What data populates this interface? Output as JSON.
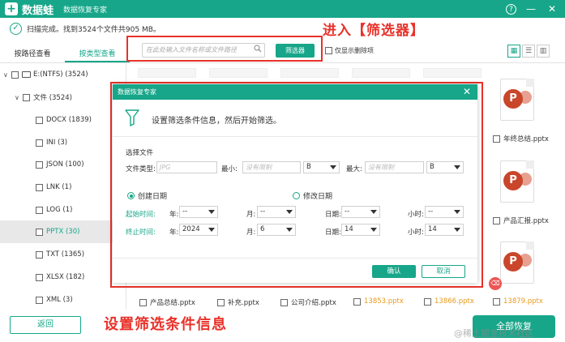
{
  "titlebar": {
    "logo_glyph": "+",
    "app_name": "数据蛙",
    "subtitle": "数据恢复专家",
    "help": "?",
    "minimize": "—",
    "close": "✕"
  },
  "status": {
    "check": "✓",
    "text": "扫描完成。找到3524个文件共905 MB。"
  },
  "annotations": {
    "top": "进入【筛选器】",
    "bottom": "设置筛选条件信息"
  },
  "tabs": [
    {
      "label": "按路径查看"
    },
    {
      "label": "按类型查看"
    }
  ],
  "toolbar": {
    "search_placeholder": "在此处输入文件名称或文件路径",
    "filter_label": "筛选器",
    "show_deleted": "仅显示删除项"
  },
  "tree": [
    {
      "arrow": "∨",
      "label": "E:(NTFS) (3524)"
    },
    {
      "arrow": "∨",
      "label": "文件 (3524)"
    },
    {
      "label": "DOCX (1839)"
    },
    {
      "label": "INI (3)"
    },
    {
      "label": "JSON (100)"
    },
    {
      "label": "LNK (1)"
    },
    {
      "label": "LOG (1)"
    },
    {
      "label": "PPTX (30)"
    },
    {
      "label": "TXT (1365)"
    },
    {
      "label": "XLSX (182)"
    },
    {
      "label": "XML (3)"
    }
  ],
  "files": {
    "right_col": [
      {
        "name": "年终总结.pptx"
      },
      {
        "name": "产品汇报.pptx"
      }
    ],
    "bottom_row": [
      {
        "name": "产品总结.pptx"
      },
      {
        "name": "补充.pptx"
      },
      {
        "name": "公司介绍.pptx"
      },
      {
        "name": "13853.pptx"
      },
      {
        "name": "13866.pptx"
      },
      {
        "name": "13879.pptx"
      }
    ],
    "ppt_glyph": "P",
    "trash_glyph": "⌫"
  },
  "bottom": {
    "back": "返回",
    "recover": "全部恢复",
    "watermark": "@稀土掘金技术社区"
  },
  "modal": {
    "title": "数据恢复专家",
    "close": "✕",
    "hint": "设置筛选条件信息，然后开始筛选。",
    "select_file": "选择文件",
    "file_type_label": "文件类型:",
    "file_type_placeholder": "JPG",
    "min_label": "最小:",
    "min_placeholder": "没有限制",
    "min_unit": "B",
    "max_label": "最大:",
    "max_placeholder": "没有限制",
    "max_unit": "B",
    "created": "创建日期",
    "modified": "修改日期",
    "start_label": "起始时间:",
    "end_label": "终止时间:",
    "year": "年:",
    "month": "月:",
    "day": "日期:",
    "hour": "小时:",
    "start": {
      "year": "--",
      "month": "--",
      "day": "--",
      "hour": "--"
    },
    "end": {
      "year": "2024",
      "month": "6",
      "day": "14",
      "hour": "14"
    },
    "ok": "确认",
    "cancel": "取消"
  }
}
